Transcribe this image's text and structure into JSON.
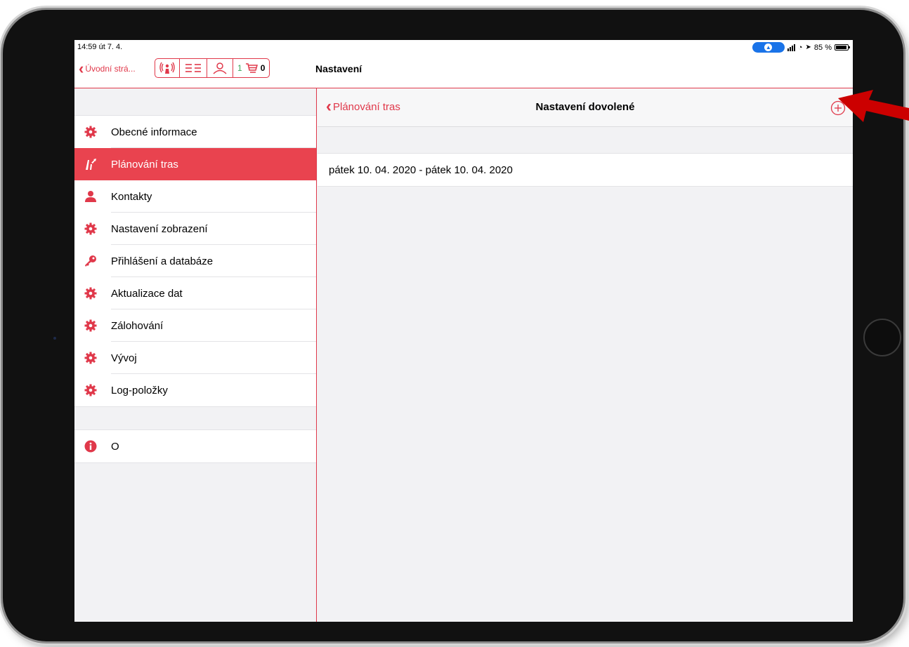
{
  "status_bar": {
    "time": "14:59  út 7. 4.",
    "battery": "85 %"
  },
  "app_bar": {
    "back_label": "Úvodní strá...",
    "cart_count": "1",
    "cart_total": "0",
    "title": "Nastavení"
  },
  "sidebar": {
    "items": [
      {
        "label": "Obecné informace",
        "icon": "gear-icon"
      },
      {
        "label": "Plánování tras",
        "icon": "route-icon",
        "active": true
      },
      {
        "label": "Kontakty",
        "icon": "person-icon"
      },
      {
        "label": "Nastavení zobrazení",
        "icon": "gear-icon"
      },
      {
        "label": "Přihlášení a databáze",
        "icon": "key-icon"
      },
      {
        "label": "Aktualizace dat",
        "icon": "gear-icon"
      },
      {
        "label": "Zálohování",
        "icon": "gear-icon"
      },
      {
        "label": "Vývoj",
        "icon": "gear-icon"
      },
      {
        "label": "Log-položky",
        "icon": "gear-icon"
      }
    ],
    "about": {
      "label": "O",
      "icon": "info-icon"
    }
  },
  "detail": {
    "back_label": "Plánování tras",
    "title": "Nastavení dovolené",
    "rows": [
      "pátek 10. 04. 2020 - pátek 10. 04. 2020"
    ]
  },
  "colors": {
    "accent": "#e0384a",
    "active_row": "#e9434f",
    "annotation_arrow": "#cc0000",
    "cart_count": "#3ba85b"
  }
}
